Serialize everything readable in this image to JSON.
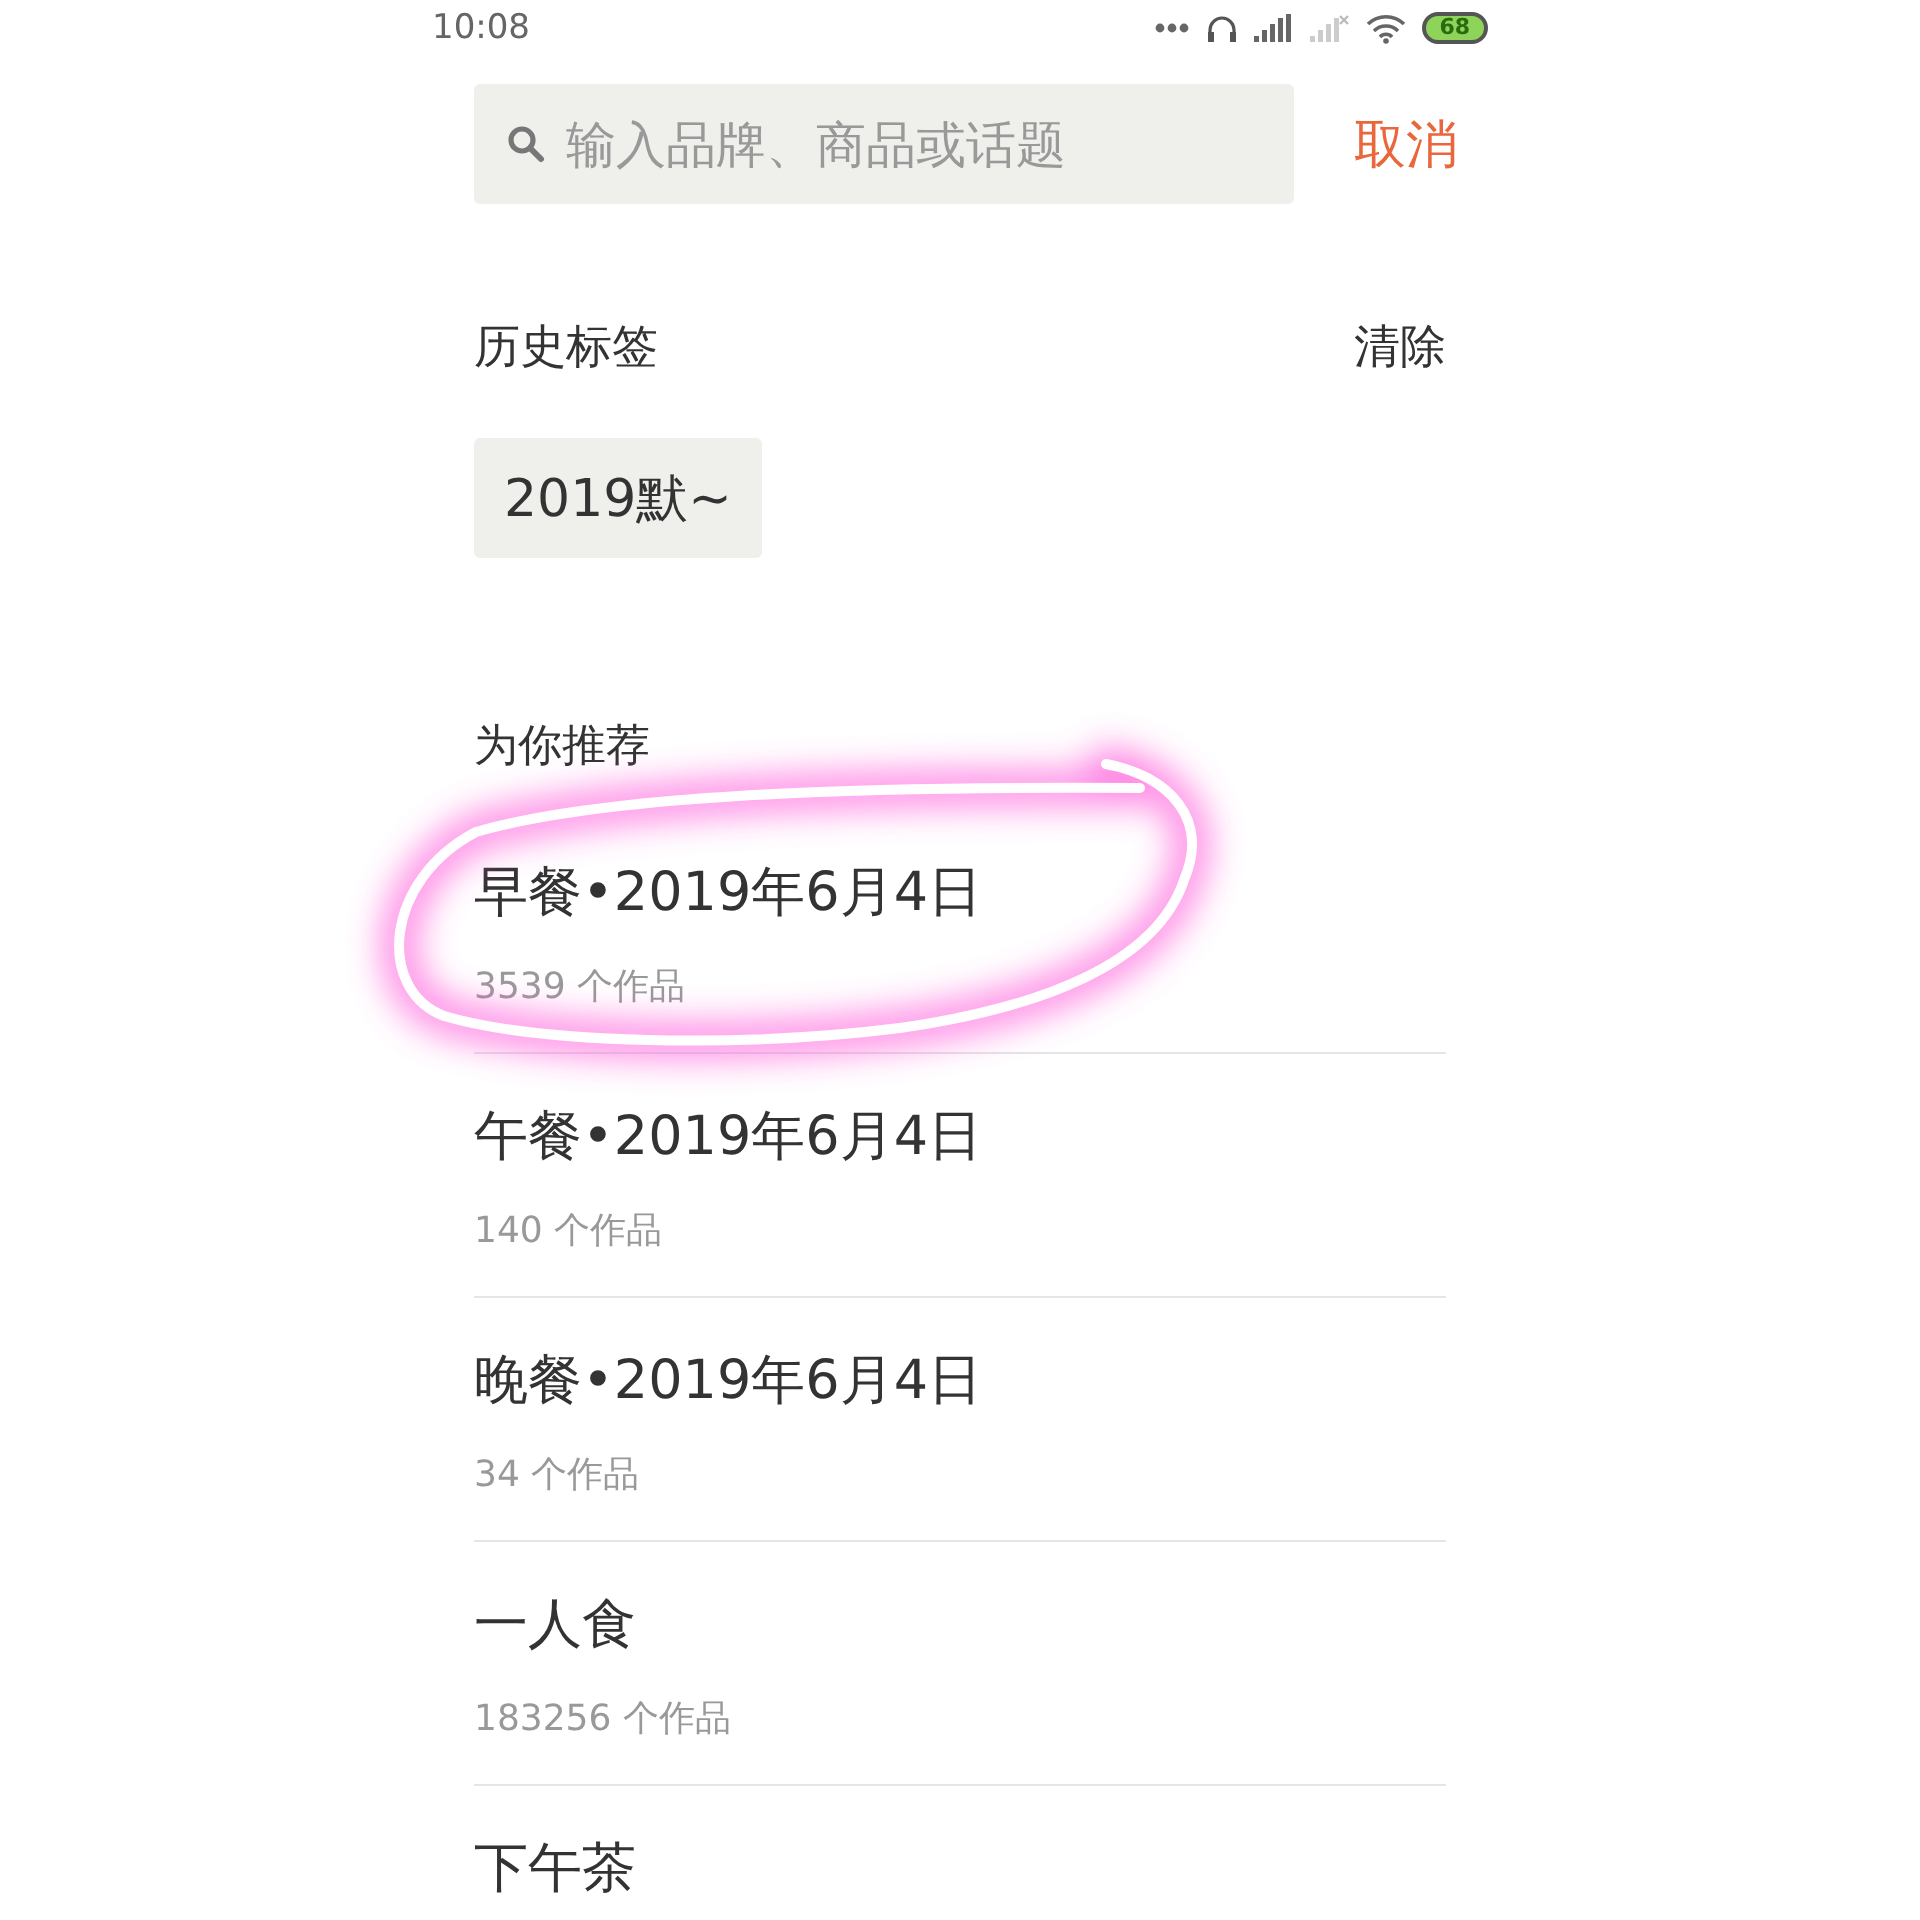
{
  "status_bar": {
    "time": "10:08",
    "battery": "68"
  },
  "search": {
    "placeholder": "输入品牌、商品或话题",
    "cancel": "取消"
  },
  "history": {
    "title": "历史标签",
    "clear": "清除",
    "tags": [
      "2019默~"
    ]
  },
  "recommend": {
    "title": "为你推荐",
    "items": [
      {
        "title": "早餐•2019年6月4日",
        "count": "3539 个作品"
      },
      {
        "title": "午餐•2019年6月4日",
        "count": "140 个作品"
      },
      {
        "title": "晚餐•2019年6月4日",
        "count": "34 个作品"
      },
      {
        "title": "一人食",
        "count": "183256 个作品"
      },
      {
        "title": "下午茶"
      }
    ]
  }
}
